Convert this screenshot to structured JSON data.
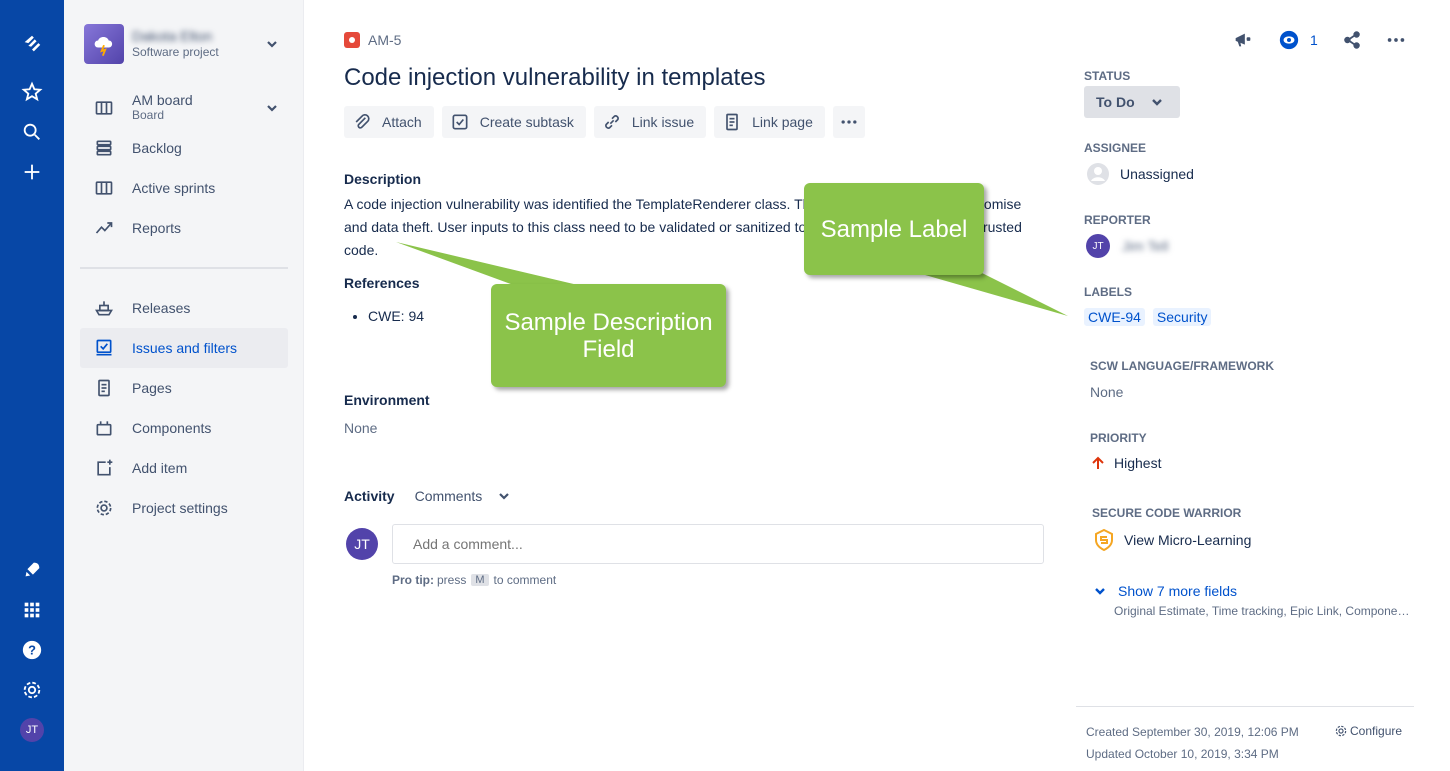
{
  "project": {
    "name": "Dakota Elton",
    "type": "Software project"
  },
  "sidebar": {
    "board": {
      "label": "AM board",
      "sub": "Board"
    },
    "items": [
      {
        "label": "Backlog"
      },
      {
        "label": "Active sprints"
      },
      {
        "label": "Reports"
      },
      {
        "label": "Releases"
      },
      {
        "label": "Issues and filters"
      },
      {
        "label": "Pages"
      },
      {
        "label": "Components"
      },
      {
        "label": "Add item"
      },
      {
        "label": "Project settings"
      }
    ]
  },
  "global_nav": {
    "avatar_initials": "JT"
  },
  "issue": {
    "key": "AM-5",
    "title": "Code injection vulnerability in templates",
    "toolbar": {
      "attach": "Attach",
      "create_subtask": "Create subtask",
      "link_issue": "Link issue",
      "link_page": "Link page"
    },
    "description_heading": "Description",
    "description": "A code injection vulnerability was identified the TemplateRenderer class. This can lead to system compromise and data theft. User inputs to this class need to be validated or sanitized to prevent the execution of untrusted code.",
    "references_heading": "References",
    "references": [
      "CWE: 94"
    ],
    "environment_heading": "Environment",
    "environment_value": "None",
    "activity_heading": "Activity",
    "activity_filter": "Comments",
    "comment_avatar": "JT",
    "comment_placeholder": "Add a comment...",
    "protip_label": "Pro tip:",
    "protip_press": "press",
    "protip_key": "M",
    "protip_suffix": "to comment"
  },
  "right_panel": {
    "watchers": "1",
    "status_label": "STATUS",
    "status_value": "To Do",
    "assignee_label": "ASSIGNEE",
    "assignee_value": "Unassigned",
    "reporter_label": "REPORTER",
    "reporter_initials": "JT",
    "reporter_name": "Jim Tell",
    "labels_label": "LABELS",
    "labels": [
      "CWE-94",
      "Security"
    ],
    "scw_label": "SCW LANGUAGE/FRAMEWORK",
    "scw_value": "None",
    "priority_label": "PRIORITY",
    "priority_value": "Highest",
    "secure_label": "SECURE CODE WARRIOR",
    "secure_value": "View Micro-Learning",
    "show_more": "Show 7 more fields",
    "more_fields": "Original Estimate, Time tracking, Epic Link, Components, Fix versions",
    "created": "Created September 30, 2019, 12:06 PM",
    "updated": "Updated October 10, 2019, 3:34 PM",
    "configure": "Configure"
  },
  "callouts": {
    "description": "Sample Description Field",
    "label": "Sample Label"
  },
  "colors": {
    "global_nav": "#0747a6",
    "accent": "#0052cc",
    "callout": "#8bc34a",
    "bug": "#e5493a"
  }
}
